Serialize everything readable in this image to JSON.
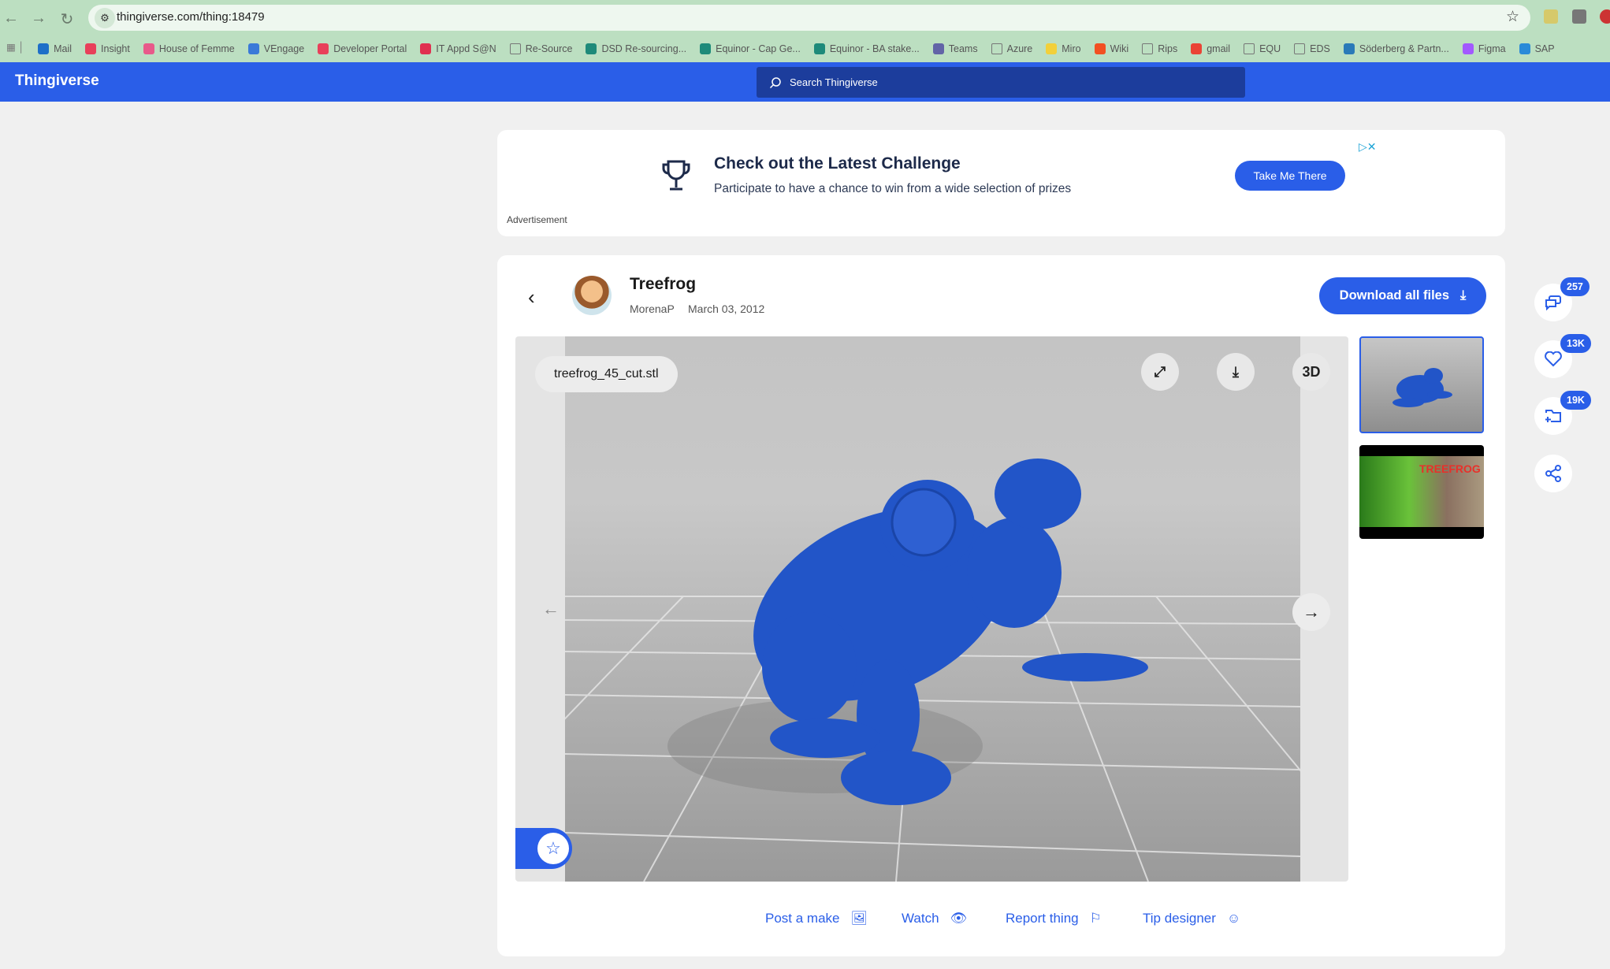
{
  "browser": {
    "url": "thingiverse.com/thing:18479",
    "bookmarks": [
      {
        "label": "Mail",
        "color": "#1e6fc8"
      },
      {
        "label": "Insight",
        "color": "#e8405a"
      },
      {
        "label": "House of Femme",
        "color": "#e85a8a"
      },
      {
        "label": "VEngage",
        "color": "#3a7ad8"
      },
      {
        "label": "Developer Portal",
        "color": "#e8405a"
      },
      {
        "label": "IT Appd S@N",
        "color": "#e03050"
      },
      {
        "label": "Re-Source",
        "color": "folder"
      },
      {
        "label": "DSD Re-sourcing...",
        "color": "#1e8a7a"
      },
      {
        "label": "Equinor - Cap Ge...",
        "color": "#1e8a7a"
      },
      {
        "label": "Equinor - BA stake...",
        "color": "#1e8a7a"
      },
      {
        "label": "Teams",
        "color": "#6264a7"
      },
      {
        "label": "Azure",
        "color": "folder"
      },
      {
        "label": "Miro",
        "color": "#f2d03a"
      },
      {
        "label": "Wiki",
        "color": "#f25022"
      },
      {
        "label": "Rips",
        "color": "folder"
      },
      {
        "label": "gmail",
        "color": "#ea4335"
      },
      {
        "label": "EQU",
        "color": "folder"
      },
      {
        "label": "EDS",
        "color": "folder"
      },
      {
        "label": "Söderberg & Partn...",
        "color": "#2a7ab8"
      },
      {
        "label": "Figma",
        "color": "#a259ff"
      },
      {
        "label": "SAP",
        "color": "#2a8ad8"
      }
    ]
  },
  "header": {
    "logo": "Thingiverse",
    "search_placeholder": "Search Thingiverse"
  },
  "ad": {
    "title": "Check out the Latest Challenge",
    "description": "Participate to have a chance to win from a wide selection of prizes",
    "button": "Take Me There",
    "label": "Advertisement"
  },
  "thing": {
    "title": "Treefrog",
    "author": "MorenaP",
    "date": "March 03, 2012",
    "download_label": "Download all files",
    "filename": "treefrog_45_cut.stl",
    "view_3d": "3D",
    "thumb2_text": "TREEFROG"
  },
  "side": {
    "comments": "257",
    "likes": "13K",
    "collections": "19K"
  },
  "actions": [
    {
      "label": "Post a make",
      "icon": "image-icon"
    },
    {
      "label": "Watch",
      "icon": "eye-icon"
    },
    {
      "label": "Report thing",
      "icon": "flag-icon"
    },
    {
      "label": "Tip designer",
      "icon": "smiley-icon"
    }
  ],
  "colors": {
    "brand": "#2a5ee8",
    "model": "#2255c8"
  }
}
